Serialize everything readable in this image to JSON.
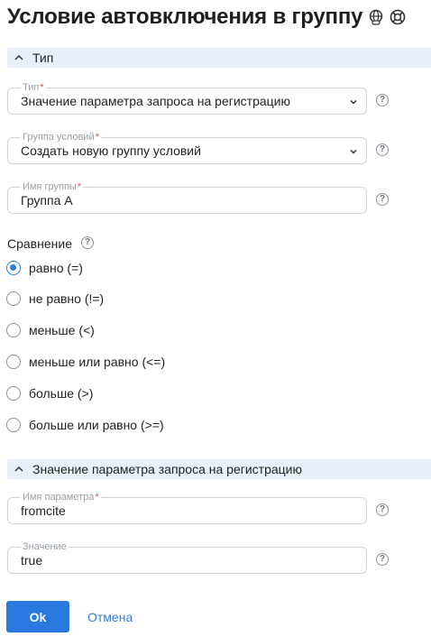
{
  "title": "Условие автовключения в группу",
  "title_icons": [
    "web-link-icon",
    "lifebuoy-icon"
  ],
  "section_type": {
    "label": "Тип",
    "icon": "chevron-up-icon"
  },
  "fields": {
    "type": {
      "label": "Тип",
      "required": "*",
      "value": "Значение параметра запроса на регистрацию"
    },
    "condition_group": {
      "label": "Группа условий",
      "required": "*",
      "value": "Создать новую группу условий"
    },
    "group_name": {
      "label": "Имя группы",
      "required": "*",
      "value": "Группа А"
    }
  },
  "comparison": {
    "label": "Сравнение",
    "options": [
      {
        "label": "равно (=)",
        "checked": true
      },
      {
        "label": "не равно (!=)",
        "checked": false
      },
      {
        "label": "меньше (<)",
        "checked": false
      },
      {
        "label": "меньше или равно (<=)",
        "checked": false
      },
      {
        "label": "больше (>)",
        "checked": false
      },
      {
        "label": "больше или равно (>=)",
        "checked": false
      }
    ]
  },
  "section_param": {
    "label": "Значение параметра запроса на регистрацию",
    "icon": "chevron-up-icon"
  },
  "param_fields": {
    "param_name": {
      "label": "Имя параметра",
      "required": "*",
      "value": "fromcite"
    },
    "value": {
      "label": "Значение",
      "value": "true"
    }
  },
  "help_glyph": "?",
  "buttons": {
    "ok": "Ok",
    "cancel": "Отмена"
  },
  "colors": {
    "accent": "#2979e0",
    "section_bg": "#e8f1fb",
    "required": "#d9534f"
  }
}
